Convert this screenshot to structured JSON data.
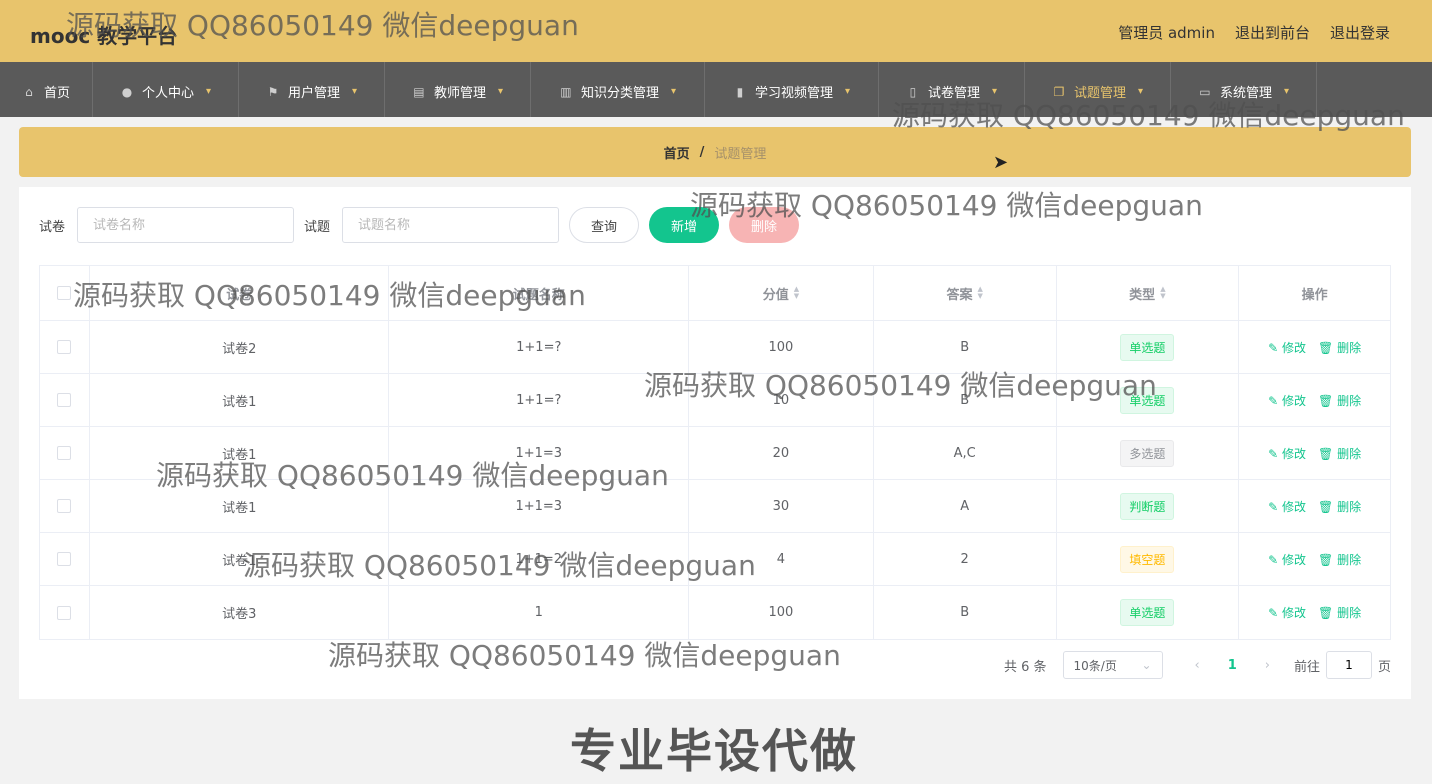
{
  "header": {
    "logo": "mooc 教学平台",
    "admin_label": "管理员 admin",
    "to_front": "退出到前台",
    "logout": "退出登录"
  },
  "nav": [
    {
      "label": "首页",
      "icon": "home-icon",
      "caret": false
    },
    {
      "label": "个人中心",
      "icon": "user-icon",
      "caret": true
    },
    {
      "label": "用户管理",
      "icon": "flag-icon",
      "caret": true
    },
    {
      "label": "教师管理",
      "icon": "teacher-icon",
      "caret": true
    },
    {
      "label": "知识分类管理",
      "icon": "category-icon",
      "caret": true
    },
    {
      "label": "学习视频管理",
      "icon": "chart-icon",
      "caret": true
    },
    {
      "label": "试卷管理",
      "icon": "paper-icon",
      "caret": true
    },
    {
      "label": "试题管理",
      "icon": "question-icon",
      "caret": true,
      "active": true
    },
    {
      "label": "系统管理",
      "icon": "system-icon",
      "caret": true
    }
  ],
  "breadcrumb": {
    "home": "首页",
    "sep": "/",
    "current": "试题管理"
  },
  "filter": {
    "paper_label": "试卷",
    "paper_placeholder": "试卷名称",
    "question_label": "试题",
    "question_placeholder": "试题名称",
    "query_btn": "查询",
    "add_btn": "新增",
    "delete_btn": "删除"
  },
  "table": {
    "headers": [
      "试卷",
      "试题名称",
      "分值",
      "答案",
      "类型",
      "操作"
    ],
    "rows": [
      {
        "paper": "试卷2",
        "question": "1+1=?",
        "score": "100",
        "answer": "B",
        "type": "单选题",
        "tag": "green"
      },
      {
        "paper": "试卷1",
        "question": "1+1=?",
        "score": "10",
        "answer": "B",
        "type": "单选题",
        "tag": "green"
      },
      {
        "paper": "试卷1",
        "question": "1+1=3",
        "score": "20",
        "answer": "A,C",
        "type": "多选题",
        "tag": "gray"
      },
      {
        "paper": "试卷1",
        "question": "1+1=3",
        "score": "30",
        "answer": "A",
        "type": "判断题",
        "tag": "green"
      },
      {
        "paper": "试卷1",
        "question": "1+1=2",
        "score": "4",
        "answer": "2",
        "type": "填空题",
        "tag": "warn"
      },
      {
        "paper": "试卷3",
        "question": "1",
        "score": "100",
        "answer": "B",
        "type": "单选题",
        "tag": "green"
      }
    ],
    "edit_label": "修改",
    "delete_label": "删除"
  },
  "pager": {
    "total": "共 6 条",
    "page_size": "10条/页",
    "current": "1",
    "goto_label": "前往",
    "goto_value": "1",
    "page_unit": "页"
  },
  "watermark": "源码获取 QQ86050149 微信deepguan",
  "footer_banner": "专业毕设代做"
}
